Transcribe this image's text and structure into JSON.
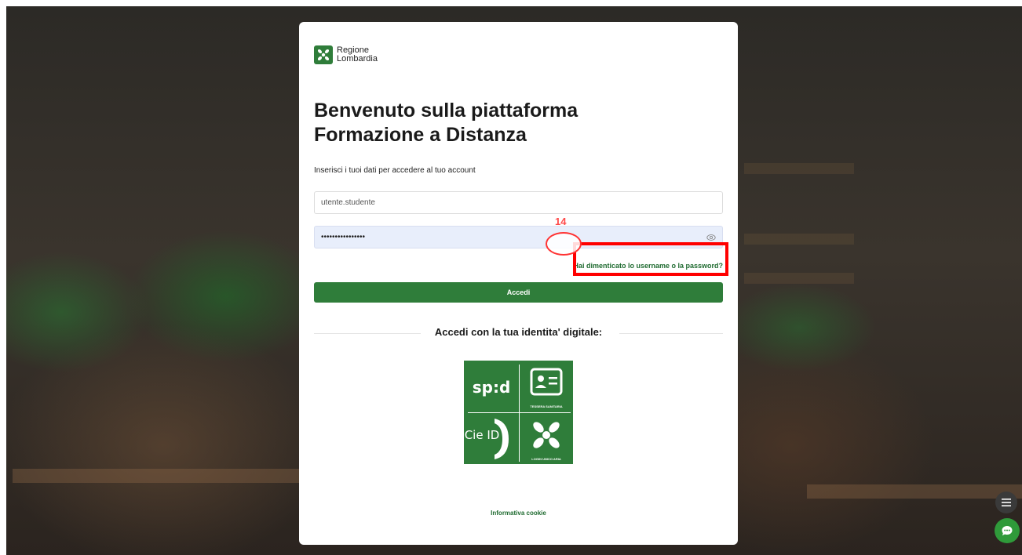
{
  "brand": {
    "line1": "Regione",
    "line2": "Lombardia",
    "color": "#2f7d3a"
  },
  "login": {
    "title_line1": "Benvenuto sulla piattaforma",
    "title_line2": "Formazione a Distanza",
    "subtitle": "Inserisci i tuoi dati per accedere al tuo account",
    "username_value": "utente.studente",
    "password_mask": "••••••••••••••••",
    "forgot_link": "Hai dimenticato lo username o la password?",
    "submit_label": "Accedi"
  },
  "digital_identity": {
    "heading": "Accedi con la tua identita' digitale:",
    "options": [
      {
        "id": "spid",
        "label": "sp:d",
        "icon": "spid-logo-icon"
      },
      {
        "id": "tessera",
        "label": "TESSERA SANITARIA",
        "icon": "id-card-icon"
      },
      {
        "id": "cie",
        "label": "Cie ID",
        "icon": "cie-logo-icon"
      },
      {
        "id": "aria",
        "label": "LOGIN UNICO ARIA",
        "icon": "aria-logo-icon"
      }
    ]
  },
  "footer": {
    "cookie_link": "Informativa cookie"
  },
  "annotation": {
    "step_number": "14",
    "highlight_color": "#ff0000"
  },
  "widgets": {
    "menu_icon": "menu-icon",
    "chat_icon": "chat-icon",
    "chat_color": "#2f9a3a"
  }
}
